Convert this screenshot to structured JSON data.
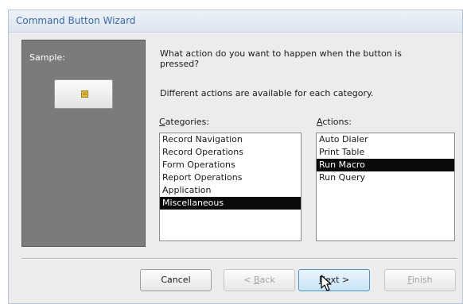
{
  "window": {
    "title": "Command Button Wizard"
  },
  "sample": {
    "label": "Sample:"
  },
  "prompt": {
    "question": "What action do you want to happen when the button is pressed?",
    "description": "Different actions are available for each category."
  },
  "categories": {
    "label_prefix": "",
    "label_accel": "C",
    "label_rest": "ategories:",
    "items": [
      "Record Navigation",
      "Record Operations",
      "Form Operations",
      "Report Operations",
      "Application",
      "Miscellaneous"
    ],
    "selected": "Miscellaneous"
  },
  "actions": {
    "label_prefix": "",
    "label_accel": "A",
    "label_rest": "ctions:",
    "items": [
      "Auto Dialer",
      "Print Table",
      "Run Macro",
      "Run Query"
    ],
    "selected": "Run Macro"
  },
  "buttons": {
    "cancel": {
      "label": "Cancel"
    },
    "back": {
      "label_prefix": "< ",
      "label_accel": "B",
      "label_rest": "ack"
    },
    "next": {
      "label_prefix": "",
      "label_accel": "N",
      "label_rest": "ext >"
    },
    "finish": {
      "label_prefix": "",
      "label_accel": "F",
      "label_rest": "inish"
    }
  },
  "colors": {
    "selection": "#0a0a0a",
    "title_text": "#3c6aa4",
    "panel": "#7b7b7b"
  }
}
